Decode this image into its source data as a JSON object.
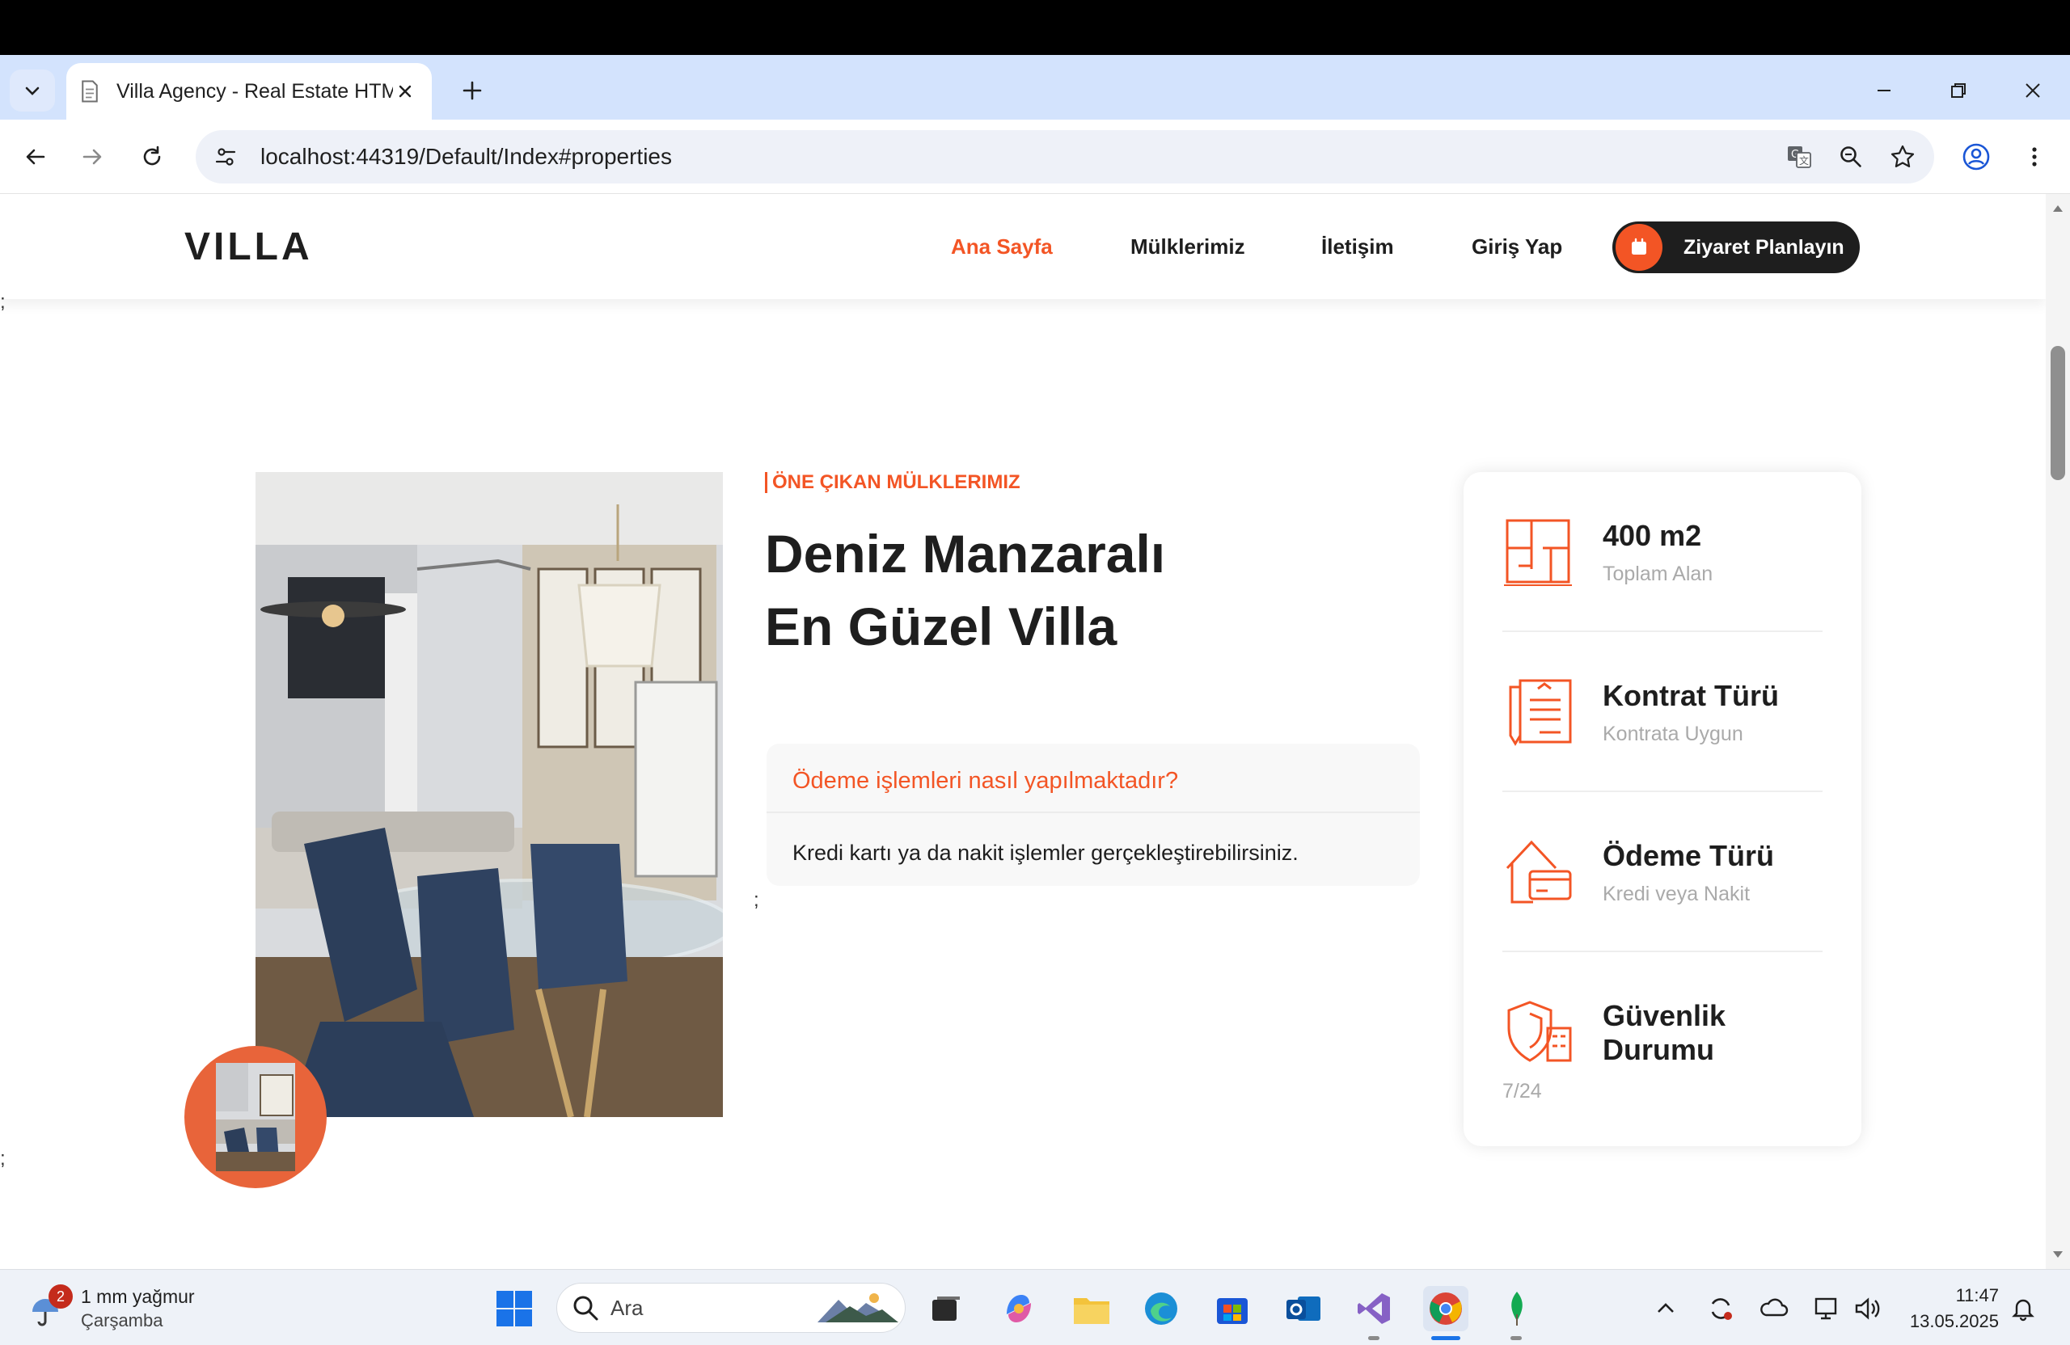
{
  "browser": {
    "tab_title": "Villa Agency - Real Estate HTML",
    "url": "localhost:44319/Default/Index#properties"
  },
  "site": {
    "logo": "VILLA",
    "nav": [
      {
        "label": "Ana Sayfa",
        "active": true
      },
      {
        "label": "Mülklerimiz",
        "active": false
      },
      {
        "label": "İletişim",
        "active": false
      },
      {
        "label": "Giriş Yap",
        "active": false
      }
    ],
    "cta_label": "Ziyaret Planlayın",
    "accent_color": "#f35525",
    "stray_text": ";"
  },
  "featured": {
    "eyebrow": "ÖNE ÇIKAN MÜLKLERIMIZ",
    "headline_line1": "Deniz Manzaralı",
    "headline_line2": "En Güzel Villa",
    "faq_question": "Ödeme işlemleri nasıl yapılmaktadır?",
    "faq_answer": "Kredi kartı ya da nakit işlemler gerçekleştirebilirsiniz."
  },
  "info_items": [
    {
      "title": "400 m2",
      "sub": "Toplam Alan",
      "icon": "floor-plan-icon"
    },
    {
      "title": "Kontrat Türü",
      "sub": "Kontrata Uygun",
      "icon": "contract-icon"
    },
    {
      "title": "Ödeme Türü",
      "sub": "Kredi veya Nakit",
      "icon": "payment-icon"
    },
    {
      "title": "Güvenlik Durumu",
      "sub": "7/24",
      "icon": "security-icon"
    }
  ],
  "taskbar": {
    "weather_badge": "2",
    "weather_temp": "1 mm yağmur",
    "weather_day": "Çarşamba",
    "search_label": "Ara",
    "time": "11:47",
    "date": "13.05.2025"
  }
}
